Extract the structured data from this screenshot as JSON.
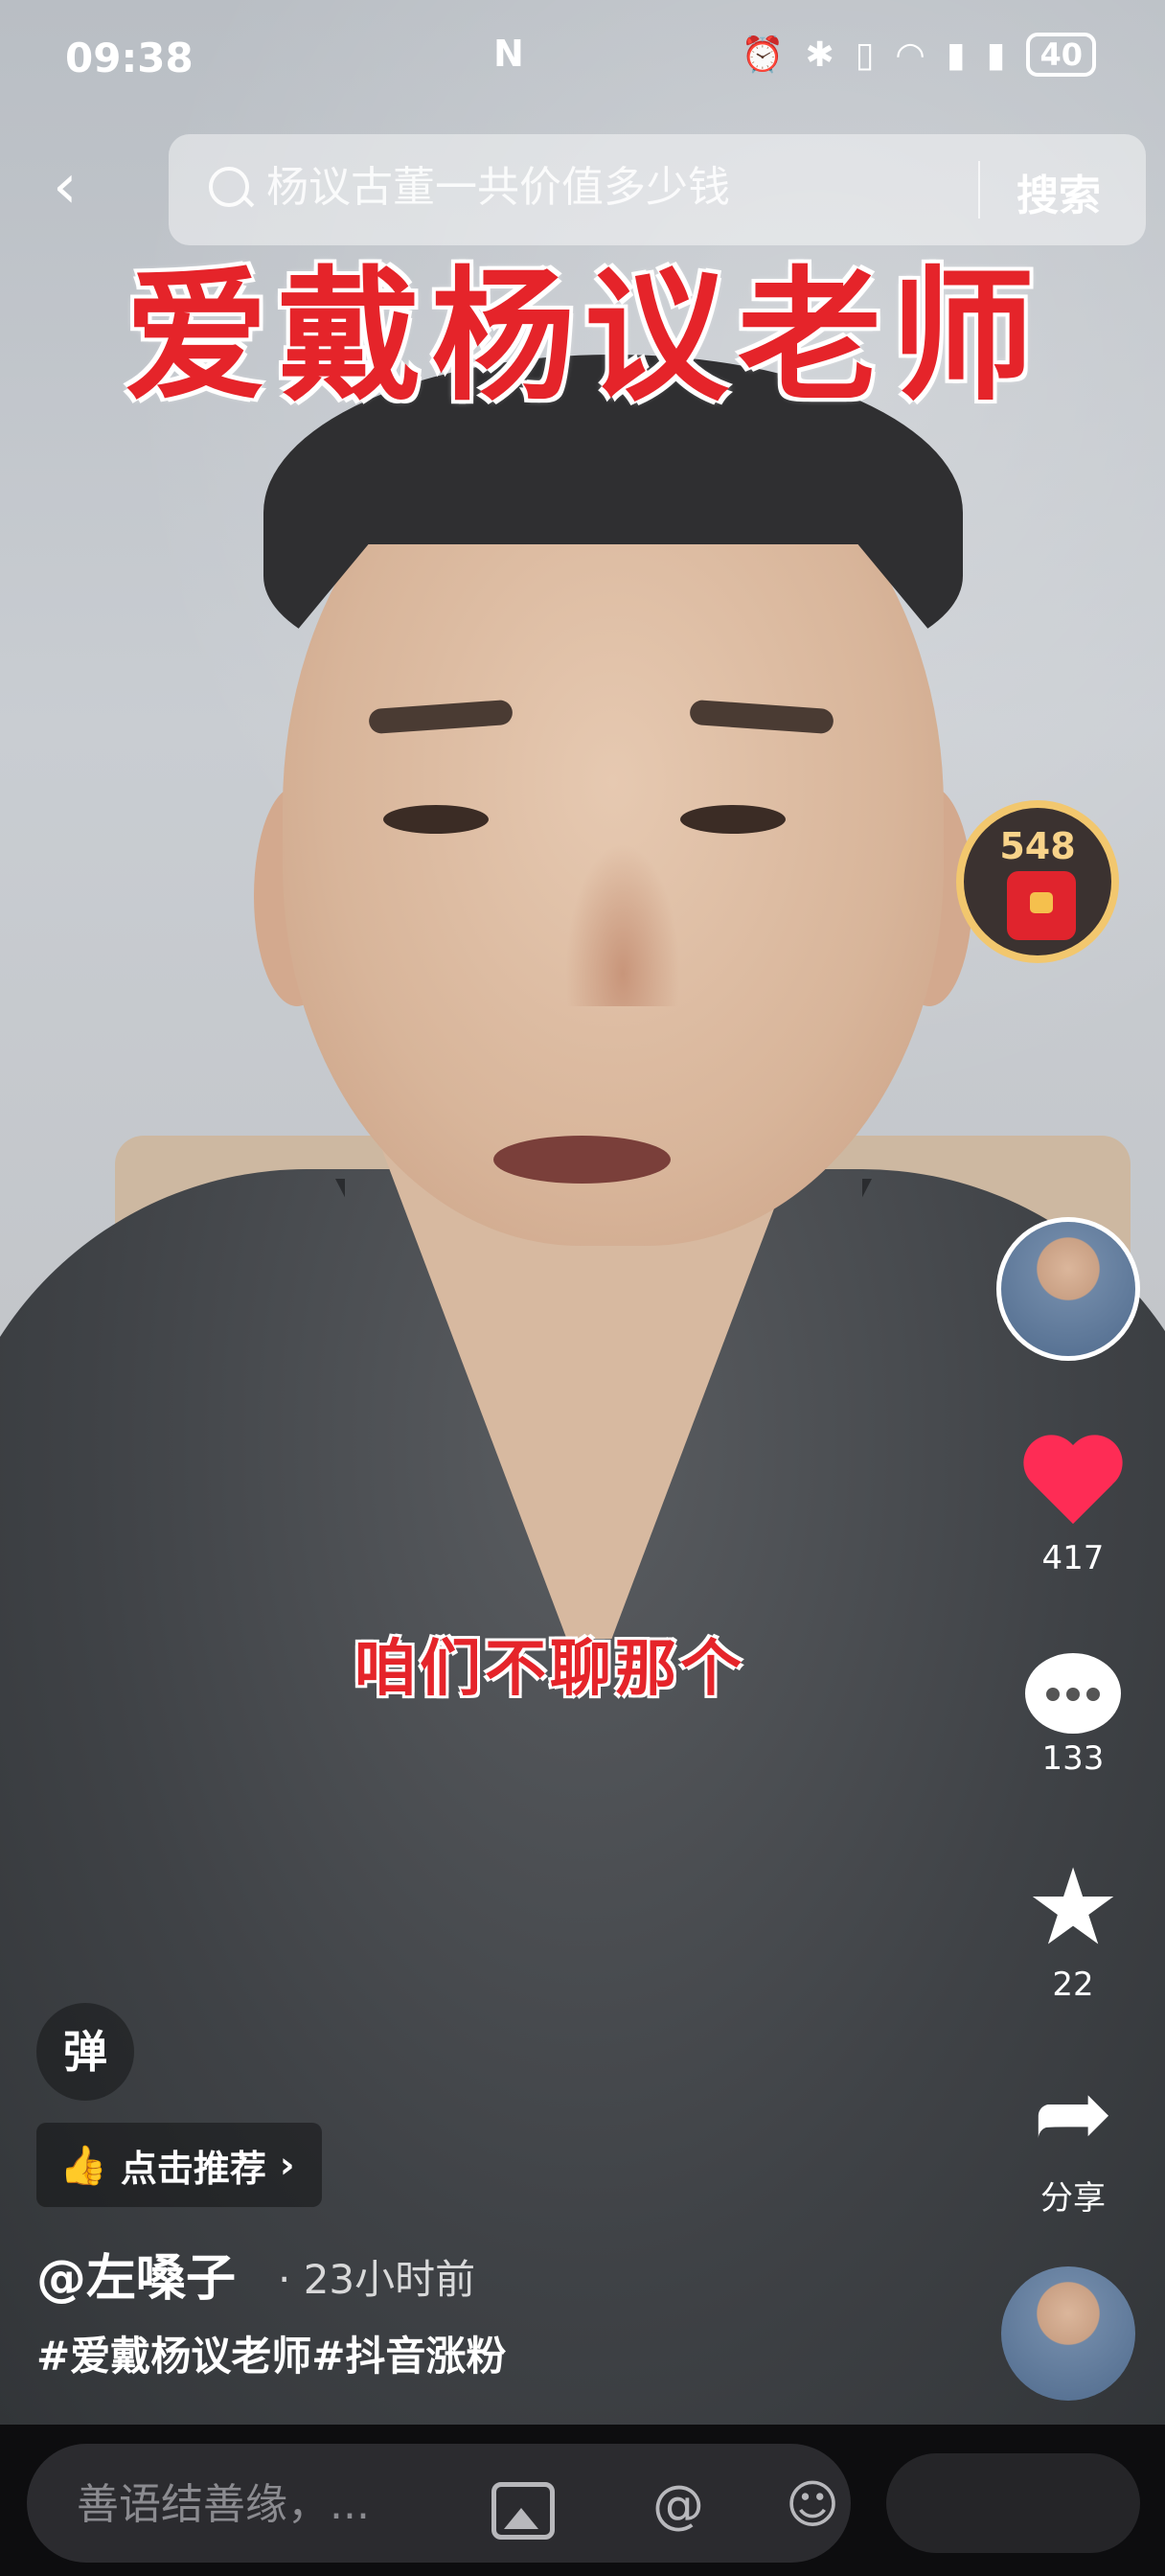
{
  "status": {
    "time": "09:38",
    "nfc": "N",
    "battery": "40"
  },
  "search": {
    "placeholder": "杨议古董一共价值多少钱",
    "button_label": "搜索"
  },
  "video": {
    "title_overlay": "爱戴杨议老师",
    "caption": "咱们不聊那个"
  },
  "red_packet": {
    "count": "548"
  },
  "actions": {
    "likes": "417",
    "comments": "133",
    "favorites": "22",
    "share_label": "分享"
  },
  "info": {
    "danmu_label": "弹",
    "recommend_label": "点击推荐",
    "author": "@左嗓子",
    "time_ago": "· 23小时前",
    "hashtags": "#爱戴杨议老师#抖音涨粉"
  },
  "bottom": {
    "comment_placeholder": "善语结善缘，..."
  },
  "colors": {
    "brand_red": "#fe2c55",
    "title_red": "#e5242a"
  }
}
